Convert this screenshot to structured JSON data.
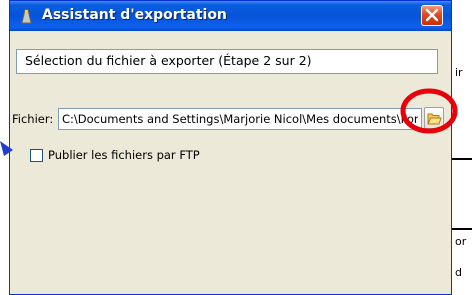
{
  "window": {
    "title": "Assistant d'exportation"
  },
  "header": {
    "text": "Sélection du fichier à exporter  (Étape 2 sur 2)"
  },
  "file_field": {
    "label": "Fichier:",
    "value": "C:\\Documents and Settings\\Marjorie Nicol\\Mes documents\\Formation.pdf"
  },
  "ftp_checkbox": {
    "label": "Publier les fichiers par FTP",
    "checked": false
  },
  "background_window": {
    "fragments": [
      "ir",
      "or",
      "d"
    ]
  },
  "annotation": {
    "circle_color": "#e8000a",
    "arrow_color": "#1e3fd0"
  },
  "icons": [
    "app-icon",
    "close-icon",
    "folder-icon",
    "arrow-annotation",
    "circle-annotation"
  ]
}
